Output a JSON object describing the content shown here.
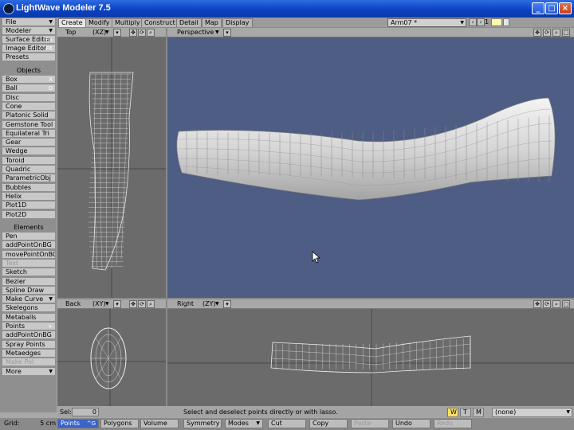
{
  "window": {
    "title": "LightWave Modeler 7.5"
  },
  "sidebar": {
    "top": [
      {
        "label": "File"
      },
      {
        "label": "Modeler"
      },
      {
        "label": "Surface Editor",
        "key": "F5"
      },
      {
        "label": "Image Editor",
        "key": "F6"
      },
      {
        "label": "Presets"
      }
    ],
    "objects_header": "Objects",
    "objects": [
      {
        "label": "Box",
        "key": "X"
      },
      {
        "label": "Ball",
        "key": "O"
      },
      {
        "label": "Disc"
      },
      {
        "label": "Cone"
      },
      {
        "label": "Platonic Solid"
      },
      {
        "label": "Gemstone Tool"
      },
      {
        "label": "Equilateral Tri"
      },
      {
        "label": "Gear"
      },
      {
        "label": "Wedge"
      },
      {
        "label": "Toroid"
      },
      {
        "label": "Quadric"
      },
      {
        "label": "ParametricObj"
      },
      {
        "label": "Bubbles"
      },
      {
        "label": "Helix"
      },
      {
        "label": "Plot1D"
      },
      {
        "label": "Plot2D"
      }
    ],
    "elements_header": "Elements",
    "elements": [
      {
        "label": "Pen"
      },
      {
        "label": "addPointOnBG"
      },
      {
        "label": "movePointOnBG"
      },
      {
        "label": "Text",
        "disabled": true
      },
      {
        "label": "Sketch"
      },
      {
        "label": "Bezier"
      },
      {
        "label": "Spline Draw"
      },
      {
        "label": "Make Curve"
      },
      {
        "label": "Skelegons"
      },
      {
        "label": "Metaballs"
      },
      {
        "label": "Points",
        "key": "+"
      },
      {
        "label": "addPointOnBG"
      },
      {
        "label": "Spray Points"
      },
      {
        "label": "Metaedges"
      },
      {
        "label": "Make Pol",
        "disabled": true
      },
      {
        "label": "More"
      }
    ]
  },
  "tabs": [
    "Create",
    "Modify",
    "Multiply",
    "Construct",
    "Detail",
    "Map",
    "Display"
  ],
  "active_tab": "Create",
  "layer": {
    "name": "Arm07 *",
    "number": "1"
  },
  "viewports": {
    "top_left": {
      "view": "Top",
      "axes": "(XZ)"
    },
    "top_right": {
      "view": "Perspective"
    },
    "bottom_left": {
      "view": "Back",
      "axes": "(XY)"
    },
    "bottom_right": {
      "view": "Right",
      "axes": "(ZY)"
    }
  },
  "status": {
    "sel_label": "Sel:",
    "sel_value": "0",
    "hint": "Select and deselect points directly or with lasso.",
    "wtm": [
      "W",
      "T",
      "M"
    ],
    "surface": "(none)"
  },
  "bottom": {
    "grid_label": "Grid:",
    "grid_value": "5 cm",
    "buttons": [
      {
        "label": "Points",
        "key": "^G"
      },
      {
        "label": "Polygons"
      },
      {
        "label": "Volume"
      },
      {
        "label": "Symmetry"
      },
      {
        "label": "Modes"
      },
      {
        "label": "Cut"
      },
      {
        "label": "Copy"
      },
      {
        "label": "Paste",
        "disabled": true
      },
      {
        "label": "Undo"
      },
      {
        "label": "Redo",
        "disabled": true
      }
    ]
  },
  "colors": {
    "viewport_bg": "#4d5d84",
    "ortho_bg": "#6b6b6b",
    "active_button": "#3a64c8"
  }
}
